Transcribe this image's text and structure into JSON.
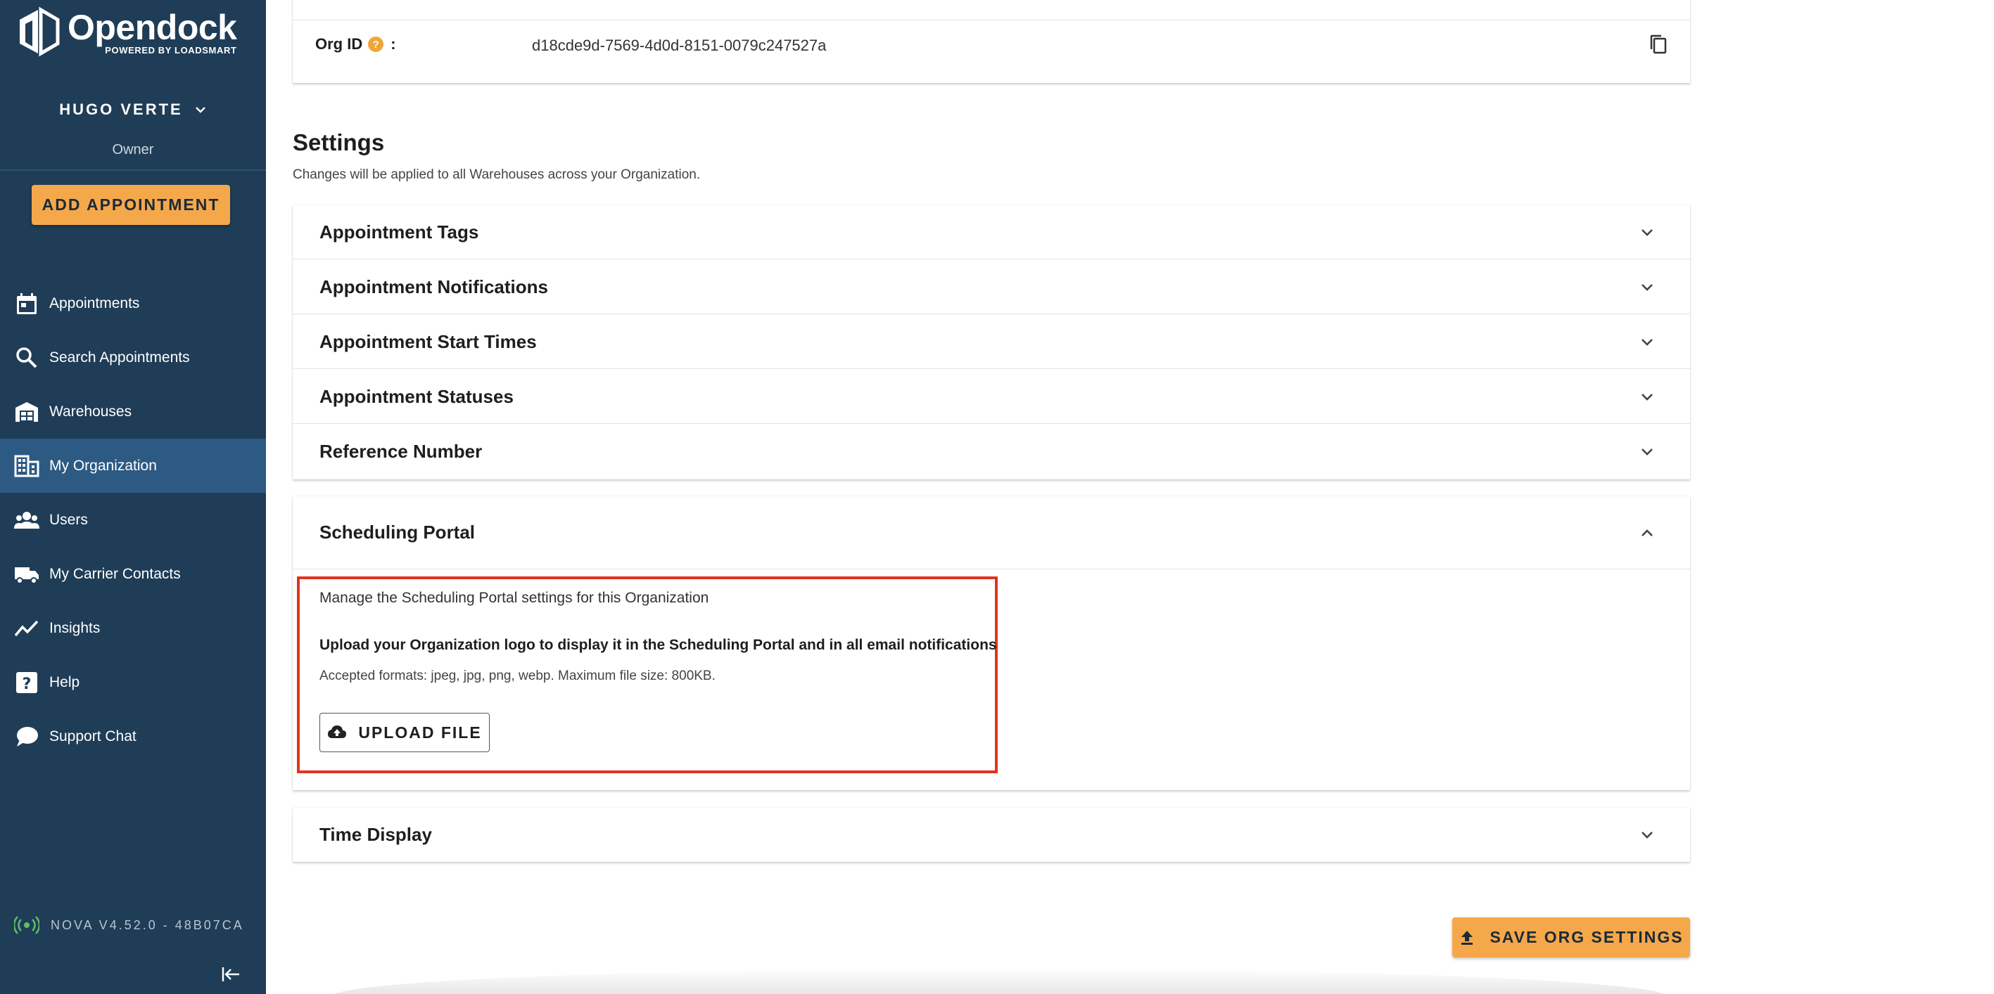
{
  "brand": {
    "name": "Opendock",
    "tagline": "POWERED BY LOADSMART",
    "accent": "#f5a84a",
    "sidebar_bg": "#1f3d57"
  },
  "user": {
    "name": "HUGO VERTE",
    "role": "Owner"
  },
  "sidebar": {
    "add_appointment": "ADD APPOINTMENT",
    "items": [
      {
        "label": "Appointments",
        "icon": "calendar-icon"
      },
      {
        "label": "Search Appointments",
        "icon": "search-icon"
      },
      {
        "label": "Warehouses",
        "icon": "warehouse-icon"
      },
      {
        "label": "My Organization",
        "icon": "building-icon",
        "active": true
      },
      {
        "label": "Users",
        "icon": "users-icon"
      },
      {
        "label": "My Carrier Contacts",
        "icon": "truck-icon"
      },
      {
        "label": "Insights",
        "icon": "trending-icon"
      },
      {
        "label": "Help",
        "icon": "help-icon"
      },
      {
        "label": "Support Chat",
        "icon": "chat-icon"
      }
    ],
    "version": "NOVA V4.52.0 - 48B07CA"
  },
  "org": {
    "id_label": "Org ID",
    "id_help": "?",
    "id_colon": ":",
    "id_value": "d18cde9d-7569-4d0d-8151-0079c247527a"
  },
  "settings": {
    "title": "Settings",
    "subtitle": "Changes will be applied to all Warehouses across your Organization.",
    "sections": [
      "Appointment Tags",
      "Appointment Notifications",
      "Appointment Start Times",
      "Appointment Statuses",
      "Reference Number"
    ],
    "portal": {
      "title": "Scheduling Portal",
      "description": "Manage the Scheduling Portal settings for this Organization",
      "upload_title": "Upload your Organization logo to display it in the Scheduling Portal and in all email notifications",
      "formats": "Accepted formats: jpeg, jpg, png, webp. Maximum file size: 800KB.",
      "upload_button": "UPLOAD FILE"
    },
    "time_display": "Time Display",
    "save_button": "SAVE ORG SETTINGS"
  }
}
